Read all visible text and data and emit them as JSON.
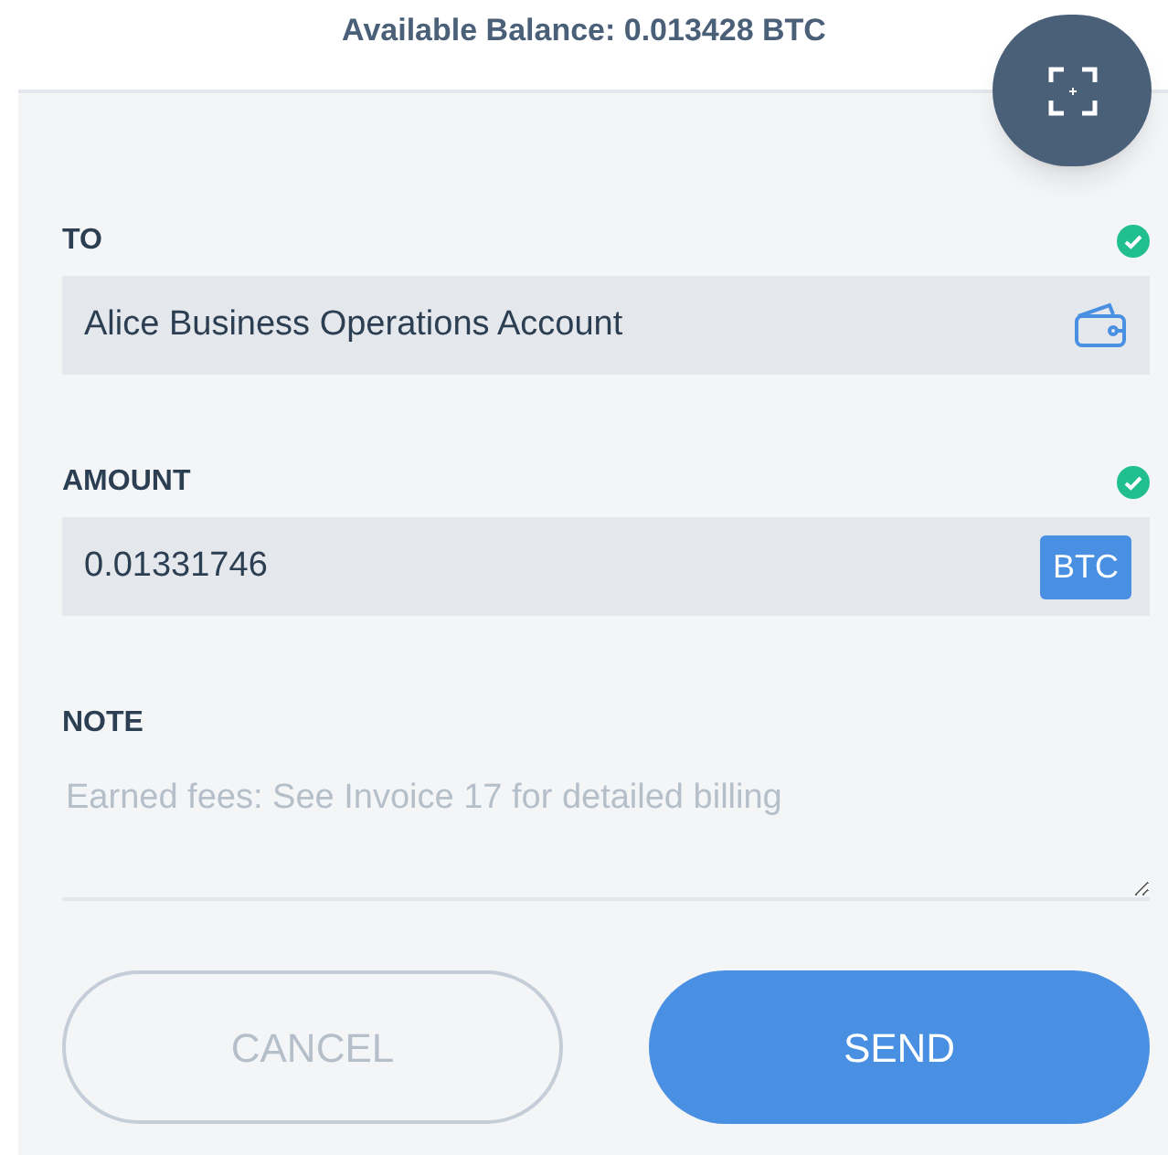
{
  "balance": "Available Balance: 0.013428 BTC",
  "fields": [
    {
      "kind": "recipient",
      "label": "TO",
      "value": "Alice Business Operations Account",
      "valid": true
    },
    {
      "kind": "amount",
      "label": "AMOUNT",
      "value": "0.01331746",
      "unit": "BTC",
      "valid": true
    },
    {
      "kind": "note",
      "label": "NOTE",
      "placeholder": "Earned fees: See Invoice 17 for detailed billing"
    }
  ],
  "buttons": [
    {
      "kind": "secondary",
      "label": "CANCEL"
    },
    {
      "kind": "primary",
      "label": "SEND"
    }
  ]
}
